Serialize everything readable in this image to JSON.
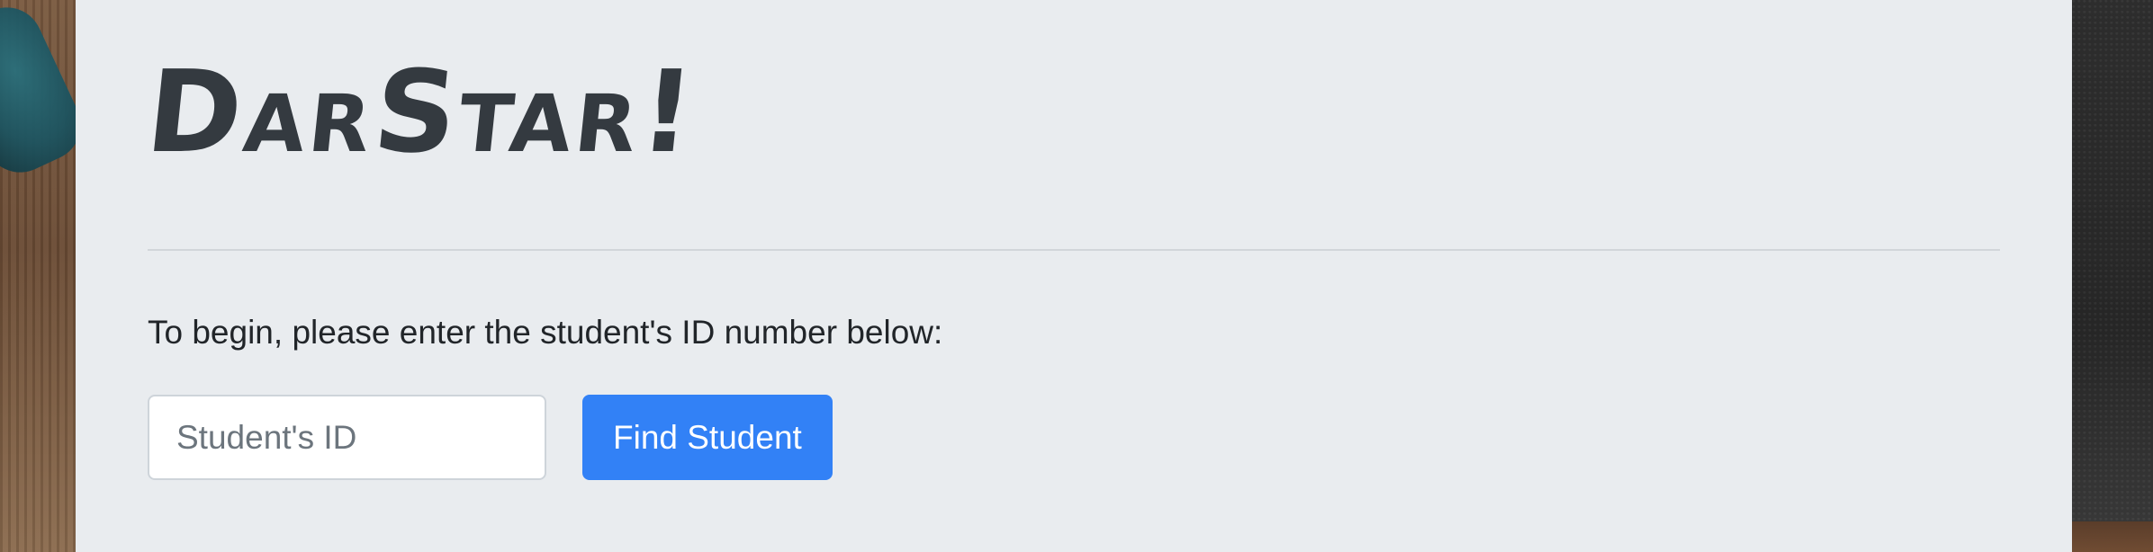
{
  "header": {
    "brand": "DarStar!"
  },
  "main": {
    "prompt": "To begin, please enter the student's ID number below:",
    "search": {
      "placeholder": "Student's ID",
      "value": "",
      "button_label": "Find Student"
    }
  },
  "colors": {
    "panel_background": "#e9ecef",
    "brand_text": "#343a40",
    "primary_button": "#3281f6",
    "body_text": "#212529"
  }
}
